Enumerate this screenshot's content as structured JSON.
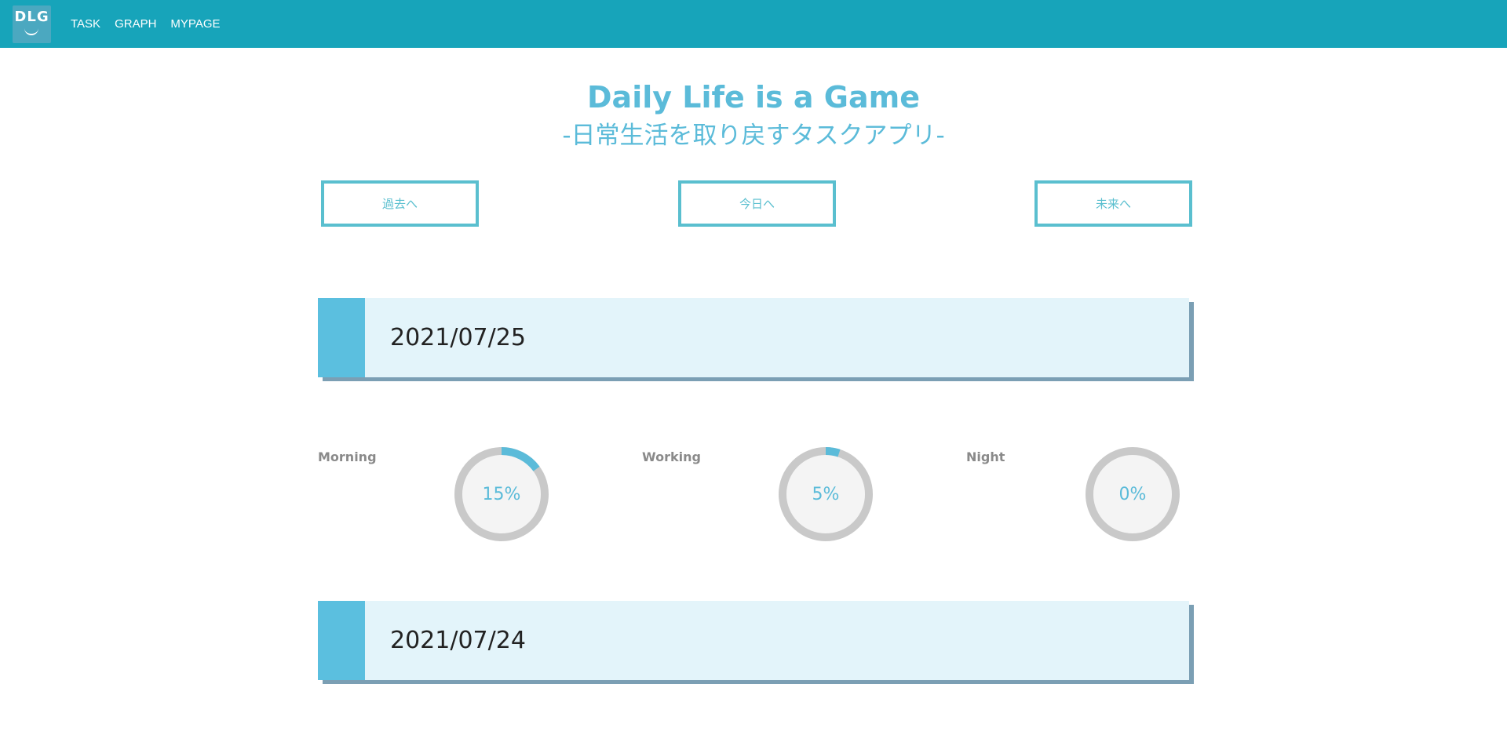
{
  "nav": {
    "logo_text": "DLG",
    "links": [
      "TASK",
      "GRAPH",
      "MYPAGE"
    ]
  },
  "hero": {
    "title": "Daily Life is a Game",
    "subtitle": "-日常生活を取り戻すタスクアプリ-"
  },
  "buttons": {
    "past": "過去へ",
    "today": "今日へ",
    "future": "未来へ"
  },
  "days": [
    {
      "date": "2021/07/25",
      "progress": [
        {
          "label": "Morning",
          "value": 15,
          "text": "15%"
        },
        {
          "label": "Working",
          "value": 5,
          "text": "5%"
        },
        {
          "label": "Night",
          "value": 0,
          "text": "0%"
        }
      ]
    },
    {
      "date": "2021/07/24"
    }
  ],
  "colors": {
    "navbar": "#17a4ba",
    "accent": "#5bbbd9",
    "ring_track": "#c9c9c9",
    "ring_fill": "#5bbbd9",
    "card_bg": "#e3f4fa"
  }
}
